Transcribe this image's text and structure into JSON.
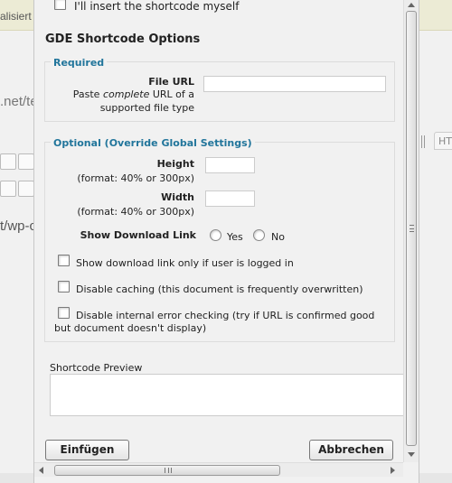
{
  "background": {
    "topbar_fragment": "alisiert",
    "url_fragment": ".net/te",
    "path_fragment": "t/wp-c",
    "right_tab_fragment": "HT"
  },
  "dialog": {
    "insert_self_label": "I'll insert the shortcode myself",
    "title": "GDE Shortcode Options",
    "required": {
      "legend": "Required",
      "file_url_label": "File URL",
      "file_url_help_1a": "Paste ",
      "file_url_help_1b": "complete",
      "file_url_help_1c": " URL of a",
      "file_url_help_2": "supported file type",
      "file_url_value": ""
    },
    "optional": {
      "legend": "Optional (Override Global Settings)",
      "height_label": "Height",
      "height_help": "(format: 40% or 300px)",
      "height_value": "",
      "width_label": "Width",
      "width_help": "(format: 40% or 300px)",
      "width_value": "",
      "show_download_label": "Show Download Link",
      "yes_label": "Yes",
      "no_label": "No",
      "logged_in_label": "Show download link only if user is logged in",
      "disable_caching_label": "Disable caching (this document is frequently overwritten)",
      "disable_error_label_1": "Disable internal error checking (try if URL is confirmed good",
      "disable_error_label_2": "but document doesn't display)"
    },
    "preview_label": "Shortcode Preview",
    "preview_value": "",
    "insert_button": "Einfügen",
    "cancel_button": "Abbrechen"
  }
}
